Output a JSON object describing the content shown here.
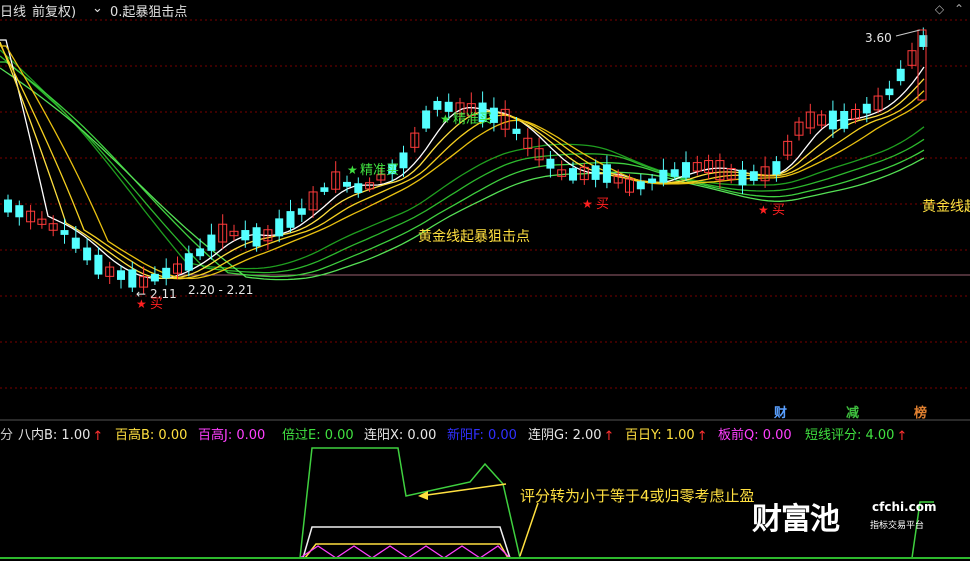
{
  "header": {
    "period": "日线",
    "adjust": "前复权)",
    "indicator_name": "0.起暴狙击点"
  },
  "price_labels": {
    "high_value": "3.60",
    "low_value": "2.11",
    "range_text": "2.20 - 2.21"
  },
  "signals": {
    "buy": "买",
    "precise_buy": "精准买"
  },
  "annotations": {
    "golden_line_1": "黄金线起暴狙击点",
    "golden_line_2": "黄金线起"
  },
  "tabs": [
    {
      "label": "财",
      "color": "#5aa0ff"
    },
    {
      "label": "减",
      "color": "#3fbf3f"
    },
    {
      "label": "榜",
      "color": "#e08030"
    }
  ],
  "indicator_bar": [
    {
      "text": "分",
      "color": "#c8c8c8"
    },
    {
      "text": "八内B: 1.00",
      "color": "#e6e6e6",
      "arrow": "↑"
    },
    {
      "text": "百高B: 0.00",
      "color": "#ffe040"
    },
    {
      "text": "百高J: 0.00",
      "color": "#ff40ff"
    },
    {
      "text": "倍过E: 0.00",
      "color": "#40e040"
    },
    {
      "text": "连阳X: 0.00",
      "color": "#e6e6e6"
    },
    {
      "text": "新阳F: 0.00",
      "color": "#3030ff"
    },
    {
      "text": "连阴G: 2.00",
      "color": "#e6e6e6",
      "arrow": "↑"
    },
    {
      "text": "百日Y: 1.00",
      "color": "#ffe040",
      "arrow": "↑"
    },
    {
      "text": "板前Q: 0.00",
      "color": "#ff40ff"
    },
    {
      "text": "短线评分: 4.00",
      "color": "#40e040",
      "arrow": "↑"
    }
  ],
  "sub_annotation": "评分转为小于等于4或归零考虑止盈",
  "watermark": {
    "brand": "财富池",
    "url": "cfchi.com",
    "tagline": "指标交易平台"
  },
  "colors": {
    "up": "#ff3b3b",
    "down": "#54ffff",
    "grid": "#7a0000",
    "yellow": "#ffe040",
    "green": "#2db82d",
    "accent_red": "#ff2020"
  }
}
